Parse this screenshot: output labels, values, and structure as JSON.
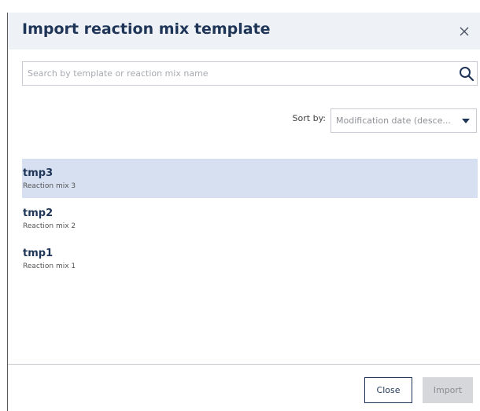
{
  "dialog": {
    "title": "Import reaction mix template",
    "close_icon": "close-icon"
  },
  "search": {
    "placeholder": "Search by template or reaction mix name",
    "value": "",
    "icon": "search-icon"
  },
  "sort": {
    "label": "Sort by:",
    "selected": "Modification date (desce...",
    "icon": "caret-down-icon"
  },
  "templates": [
    {
      "name": "tmp3",
      "reaction_mix": "Reaction mix 3",
      "selected": true
    },
    {
      "name": "tmp2",
      "reaction_mix": "Reaction mix 2",
      "selected": false
    },
    {
      "name": "tmp1",
      "reaction_mix": "Reaction mix 1",
      "selected": false
    }
  ],
  "footer": {
    "close_label": "Close",
    "import_label": "Import",
    "import_enabled": false
  },
  "colors": {
    "header_bg": "#eef1f6",
    "title": "#1f3557",
    "selected_row": "#d6e0f0",
    "disabled_button": "#d5d7da"
  }
}
